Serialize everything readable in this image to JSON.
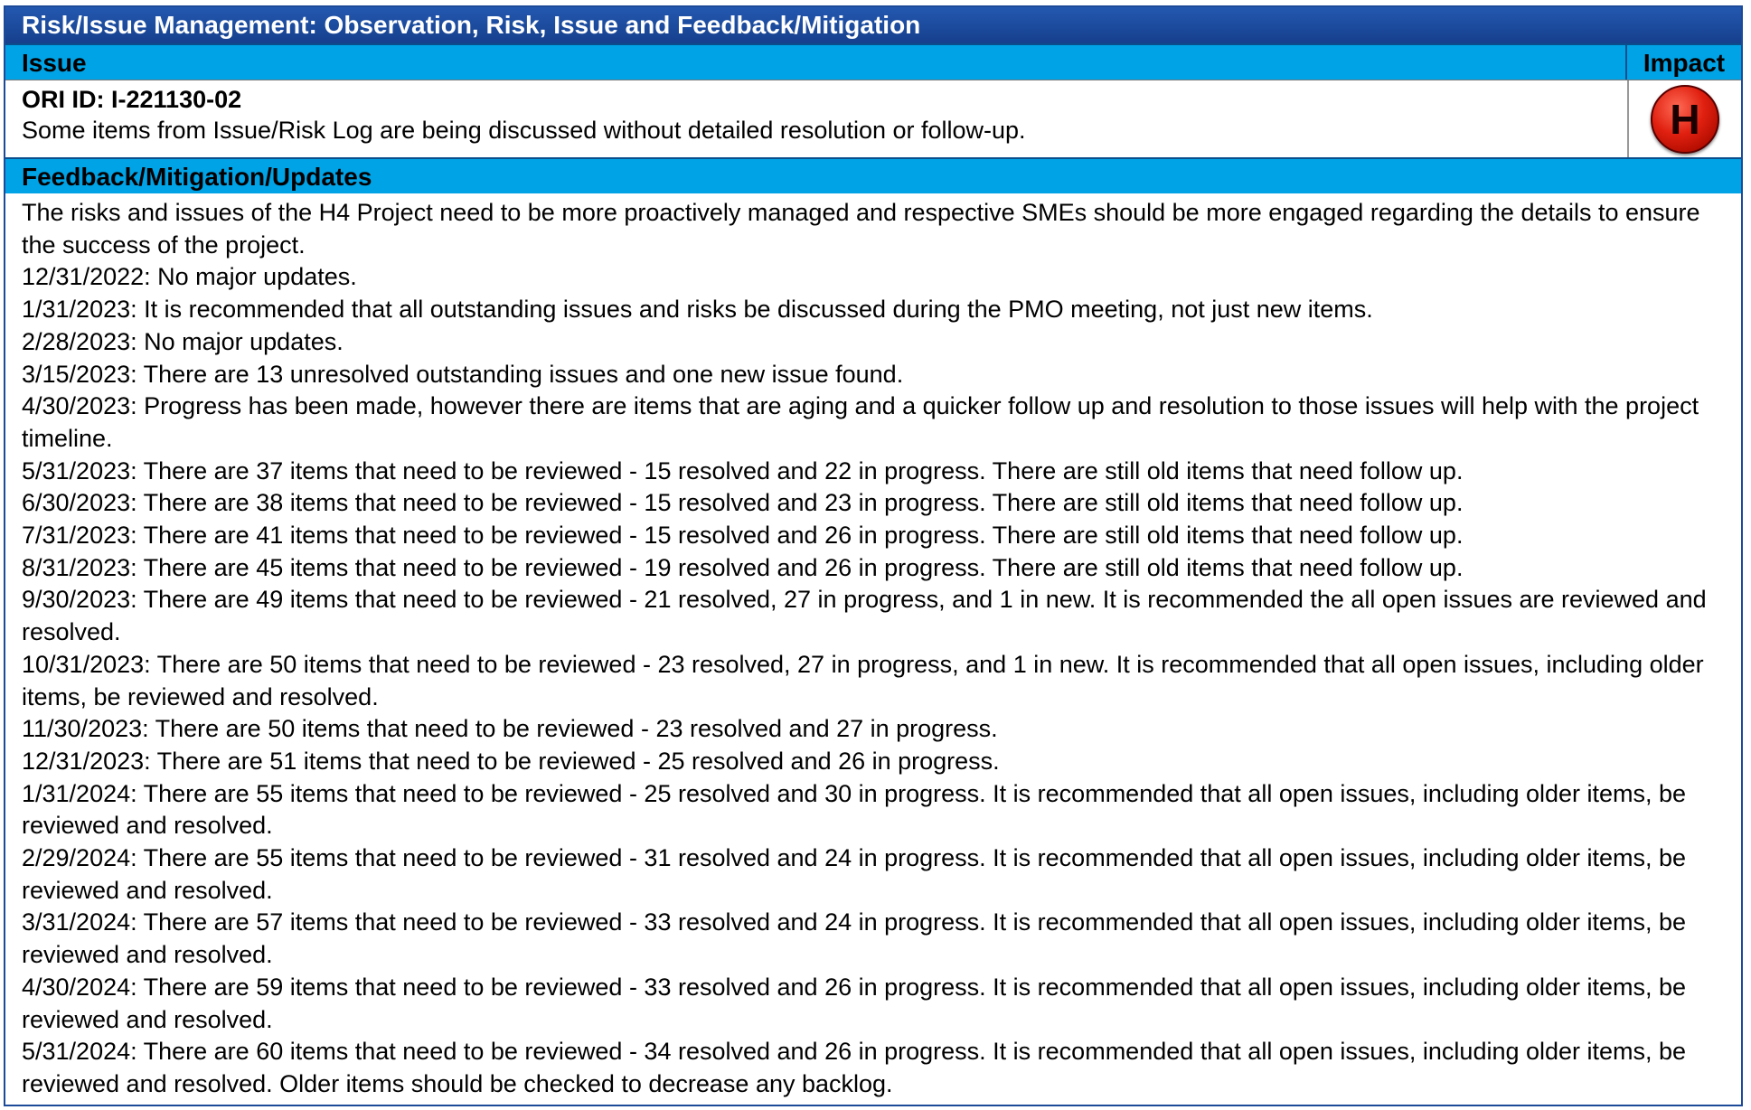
{
  "title": "Risk/Issue Management: Observation, Risk, Issue and Feedback/Mitigation",
  "header": {
    "issue_label": "Issue",
    "impact_label": "Impact"
  },
  "issue": {
    "ori_id": "ORI ID: I-221130-02",
    "description": "Some items from Issue/Risk Log are being discussed without detailed resolution or follow-up.",
    "impact_level": "H",
    "impact_color": "#e02010"
  },
  "feedback": {
    "label": "Feedback/Mitigation/Updates",
    "paragraphs": [
      "The risks and issues of the H4 Project need to be more proactively managed and respective SMEs should be more engaged regarding the details to ensure the success of the project.",
      "12/31/2022: No major updates.",
      "1/31/2023: It is recommended that all outstanding issues and risks be discussed during the PMO meeting, not just new items.",
      "2/28/2023: No major updates.",
      "3/15/2023: There are 13 unresolved outstanding issues and one new issue found.",
      "4/30/2023: Progress has been made, however there are items that are aging and a quicker follow up and resolution to those issues will help with the project timeline.",
      "5/31/2023: There are 37 items that need to be reviewed  - 15 resolved and 22 in progress.  There are still old items that need follow up.",
      "6/30/2023: There are 38 items that need to be reviewed  - 15 resolved and 23 in progress.  There are still old items that need follow up.",
      "7/31/2023: There are 41 items that need to be reviewed  - 15 resolved and 26 in progress.  There are still old items that need follow up.",
      "8/31/2023: There are 45 items that need to be reviewed  - 19 resolved and 26 in progress.  There are still old items that need follow up.",
      "9/30/2023: There are 49 items that need to be reviewed  - 21 resolved, 27 in progress, and 1 in new.  It is recommended the all open issues are reviewed and resolved.",
      "10/31/2023: There are 50 items that need to be reviewed  - 23 resolved, 27 in progress, and 1 in new.  It is recommended that all open issues, including older items, be reviewed and resolved.",
      "11/30/2023: There are 50 items that need to be reviewed  - 23 resolved and 27 in progress.",
      "12/31/2023: There are 51 items that need to be reviewed  - 25 resolved and 26 in progress.",
      "1/31/2024: There are 55 items that need to be reviewed  - 25 resolved and 30 in progress. It is recommended that all open issues, including older items, be reviewed and resolved.",
      "2/29/2024: There are 55 items that need to be reviewed  - 31 resolved and 24 in progress. It is recommended that all open issues, including older items, be reviewed and resolved.",
      "3/31/2024: There are 57 items that need to be reviewed  - 33 resolved and 24 in progress. It is recommended that all open issues, including older items, be reviewed and resolved.",
      "4/30/2024: There are 59 items that need to be reviewed  - 33 resolved and 26 in progress. It is recommended that all open issues, including older items, be reviewed and resolved.",
      "5/31/2024: There are 60 items that need to be reviewed  - 34 resolved and 26 in progress. It is recommended that all open issues, including older items, be reviewed and resolved. Older items should be checked to decrease any backlog."
    ]
  }
}
